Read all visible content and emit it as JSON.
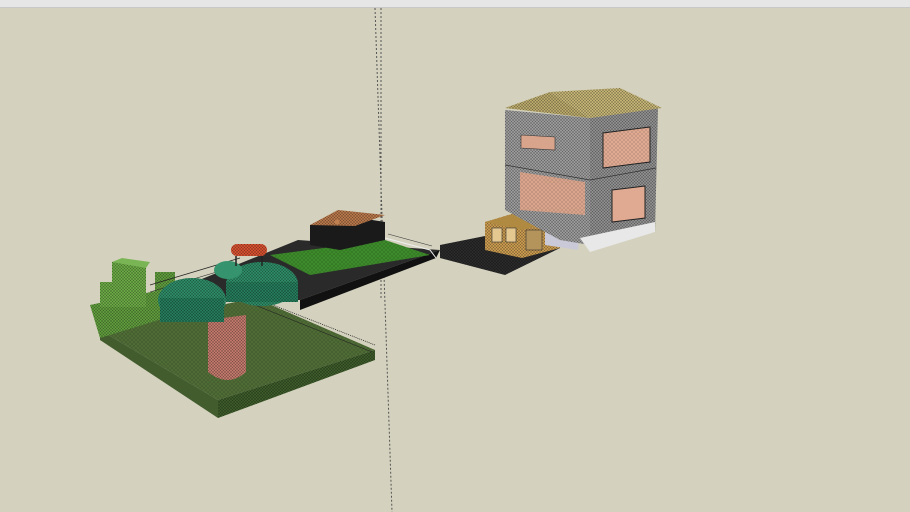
{
  "app": {
    "window_title": ""
  },
  "viewport": {
    "background_color": "#d4d2be",
    "sky_strip_color": "#e6e6e6",
    "objects": [
      {
        "name": "main-house",
        "label": ""
      },
      {
        "name": "garage",
        "label": ""
      },
      {
        "name": "shed",
        "label": ""
      },
      {
        "name": "tree",
        "label": ""
      },
      {
        "name": "hedge",
        "label": ""
      },
      {
        "name": "lawn",
        "label": ""
      },
      {
        "name": "bench",
        "label": ""
      }
    ]
  },
  "colors": {
    "lawn": "#4f6b36",
    "lawn_dark": "#3d5a2a",
    "grass_bright": "#3c8a2a",
    "hedge": "#5f9a3c",
    "tree_canopy": "#2e8a66",
    "tree_trunk": "#c0786a",
    "house_wall": "#9a9a9a",
    "house_roof": "#b8a86a",
    "window_interior": "#d9a48c",
    "shed_wall": "#c89a50",
    "garage_wall": "#1a1a1a",
    "garage_roof": "#b5764a",
    "bench": "#d25030",
    "path": "#2a2a2a",
    "axis_line": "#555555"
  }
}
